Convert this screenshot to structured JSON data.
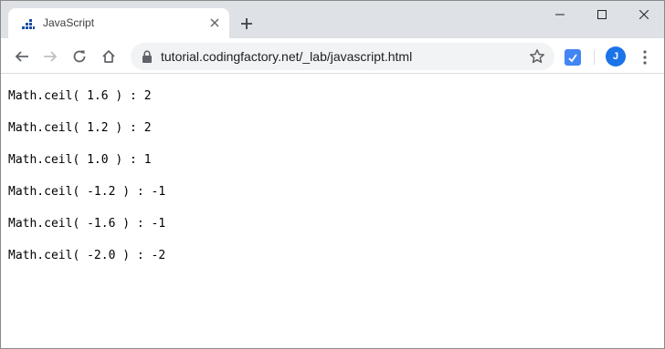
{
  "tab": {
    "title": "JavaScript",
    "favicon": "codingfactory-favicon-icon"
  },
  "address_bar": {
    "url": "tutorial.codingfactory.net/_lab/javascript.html"
  },
  "profile": {
    "initial": "J",
    "color": "#1a73e8"
  },
  "colors": {
    "tabstrip": "#dee1e6",
    "omnibox": "#f1f3f4",
    "favicon": "#1a4fa0"
  },
  "page": {
    "lines": [
      "Math.ceil( 1.6 ) : 2",
      "Math.ceil( 1.2 ) : 2",
      "Math.ceil( 1.0 ) : 1",
      "Math.ceil( -1.2 ) : -1",
      "Math.ceil( -1.6 ) : -1",
      "Math.ceil( -2.0 ) : -2"
    ]
  }
}
